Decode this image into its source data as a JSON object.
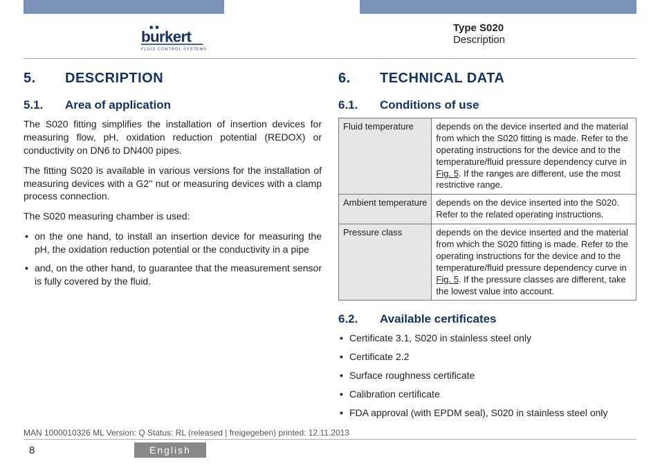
{
  "header": {
    "brand": "burkert",
    "brand_sub": "FLUID CONTROL SYSTEMS",
    "type_label": "Type S020",
    "section_label": "Description"
  },
  "col_left": {
    "sec_num": "5.",
    "sec_title": "DESCRIPTION",
    "sub1_num": "5.1.",
    "sub1_title": "Area of application",
    "p1": "The S020 fitting simplifies the installation of insertion devices for measuring flow, pH, oxidation reduction potential (REDOX) or conductivity on DN6 to DN400 pipes.",
    "p2": "The fitting S020 is available in various versions for the installation of measuring devices with a G2'' nut or measuring devices with a clamp process connection.",
    "p3": "The S020 measuring chamber is used:",
    "bullets": [
      "on the one hand, to install an insertion device for measuring the pH, the oxidation reduction potential or the conductivity in a pipe",
      "and, on the other hand, to guarantee that the measurement sensor is fully covered by the fluid."
    ]
  },
  "col_right": {
    "sec_num": "6.",
    "sec_title": "TECHNICAL DATA",
    "sub1_num": "6.1.",
    "sub1_title": "Conditions of use",
    "table": {
      "row1_label": "Fluid temperature",
      "row1_a": "depends on the device inserted and the material from which the S020 fitting is made. Refer to the operating instructions for the device and to the temperature/fluid pressure dependency curve in ",
      "row1_fig": "Fig. 5",
      "row1_b": ". If the ranges are different, use the most restrictive range.",
      "row2_label": "Ambient temperature",
      "row2_val": "depends on the device inserted into the S020. Refer to the related operating instructions.",
      "row3_label": "Pressure class",
      "row3_a": "depends on the device inserted and the material from which the S020 fitting is made. Refer to the operating instructions for the device and to the temperature/fluid pressure dependency curve in ",
      "row3_fig": "Fig. 5",
      "row3_b": ". If the pressure classes are different, take the lowest value into account."
    },
    "sub2_num": "6.2.",
    "sub2_title": "Available certificates",
    "certs": [
      "Certificate 3.1, S020 in stainless steel only",
      "Certificate 2.2",
      "Surface roughness certificate",
      "Calibration certificate",
      "FDA approval (with EPDM seal), S020 in stainless steel only"
    ]
  },
  "footer": {
    "meta": "MAN 1000010326 ML Version: Q Status: RL (released | freigegeben) printed: 12.11.2013",
    "page_num": "8",
    "language": "English"
  }
}
